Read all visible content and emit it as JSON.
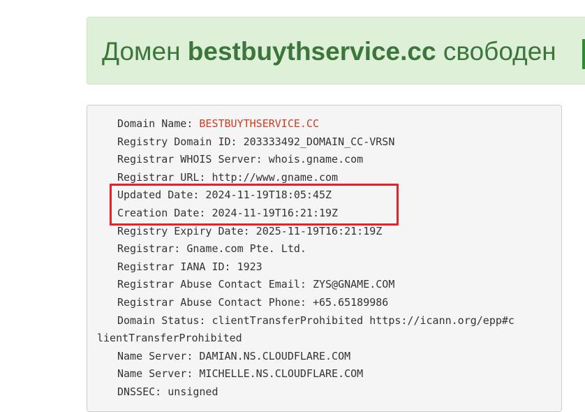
{
  "banner": {
    "prefix": "Домен",
    "domain": "bestbuythservice.cc",
    "suffix": "свободен",
    "colors": {
      "background": "#dff0d8",
      "text": "#3c763d"
    }
  },
  "whois": {
    "domain_name_label": "Domain Name: ",
    "domain_name_value": "BESTBUYTHSERVICE.CC",
    "lines": [
      "Registry Domain ID: 203333492_DOMAIN_CC-VRSN",
      "Registrar WHOIS Server: whois.gname.com",
      "Registrar URL: http://www.gname.com",
      "Updated Date: 2024-11-19T18:05:45Z",
      "Creation Date: 2024-11-19T16:21:19Z",
      "Registry Expiry Date: 2025-11-19T16:21:19Z",
      "Registrar: Gname.com Pte. Ltd.",
      "Registrar IANA ID: 1923",
      "Registrar Abuse Contact Email: ZYS@GNAME.COM",
      "Registrar Abuse Contact Phone: +65.65189986",
      "Domain Status: clientTransferProhibited https://icann.org/epp#c",
      "lientTransferProhibited",
      "Name Server: DAMIAN.NS.CLOUDFLARE.COM",
      "Name Server: MICHELLE.NS.CLOUDFLARE.COM",
      "DNSSEC: unsigned"
    ],
    "colors": {
      "value_highlight": "#d03b1f",
      "annotation_box": "#e8202a",
      "panel_background": "#f5f5f5"
    }
  }
}
